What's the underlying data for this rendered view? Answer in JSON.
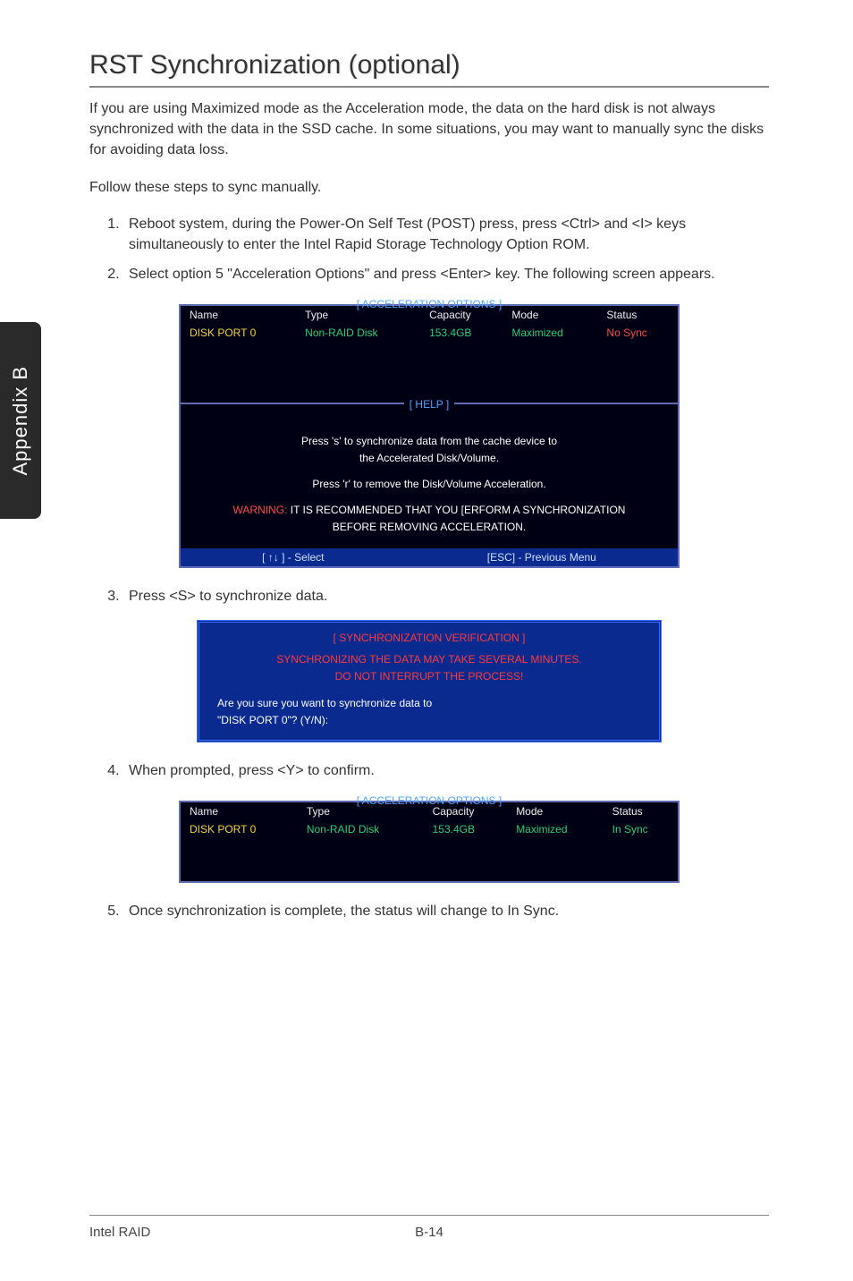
{
  "sidebar": {
    "label": "Appendix B"
  },
  "section": {
    "title": "RST Synchronization (optional)",
    "intro": "If you are using Maximized mode as the Acceleration mode, the data on the hard disk is not always synchronized with the data in the SSD cache. In some situations, you may want to manually sync the disks for avoiding data loss.",
    "follow": "Follow these steps to sync manually.",
    "step1": "Reboot system, during the Power-On Self Test (POST) press, press <Ctrl> and <I> keys simultaneously to enter the Intel Rapid Storage Technology Option ROM.",
    "step2": "Select option 5 \"Acceleration Options\" and press <Enter> key. The following screen appears.",
    "step3": "Press <S> to synchronize data.",
    "step4": "When prompted, press <Y> to confirm.",
    "step5": "Once synchronization is complete, the status will change to In Sync."
  },
  "screen1": {
    "title": "[ ACCELERATION OPTIONS ]",
    "headers": {
      "name": "Name",
      "type": "Type",
      "capacity": "Capacity",
      "mode": "Mode",
      "status": "Status"
    },
    "row": {
      "name": "DISK PORT 0",
      "type": "Non-RAID Disk",
      "capacity": "153.4GB",
      "mode": "Maximized",
      "status": "No Sync"
    },
    "helpTitle": "[  HELP  ]",
    "help1": "Press 's' to synchronize data from the cache device to",
    "help1b": "the Accelerated Disk/Volume.",
    "help2": "Press 'r' to remove the Disk/Volume Acceleration.",
    "warnLabel": "WARNING:",
    "warnText": " IT IS RECOMMENDED THAT YOU [ERFORM A SYNCHRONIZATION",
    "warnText2": "BEFORE REMOVING ACCELERATION.",
    "footerLeft": "[ ↑↓ ] - Select",
    "footerRight": "[ESC] - Previous Menu"
  },
  "screen2": {
    "title": "[ SYNCHRONIZATION VERIFICATION ]",
    "line1": "SYNCHRONIZING THE DATA MAY TAKE SEVERAL MINUTES.",
    "line2": "DO NOT INTERRUPT THE PROCESS!",
    "q1": "Are you sure you want to synchronize data to",
    "q2": "\"DISK PORT 0\"? (Y/N):"
  },
  "screen3": {
    "title": "[ ACCELERATION OPTIONS ]",
    "headers": {
      "name": "Name",
      "type": "Type",
      "capacity": "Capacity",
      "mode": "Mode",
      "status": "Status"
    },
    "row": {
      "name": "DISK PORT 0",
      "type": "Non-RAID Disk",
      "capacity": "153.4GB",
      "mode": "Maximized",
      "status": "In Sync"
    }
  },
  "footer": {
    "left": "Intel RAID",
    "page": "B-14"
  }
}
